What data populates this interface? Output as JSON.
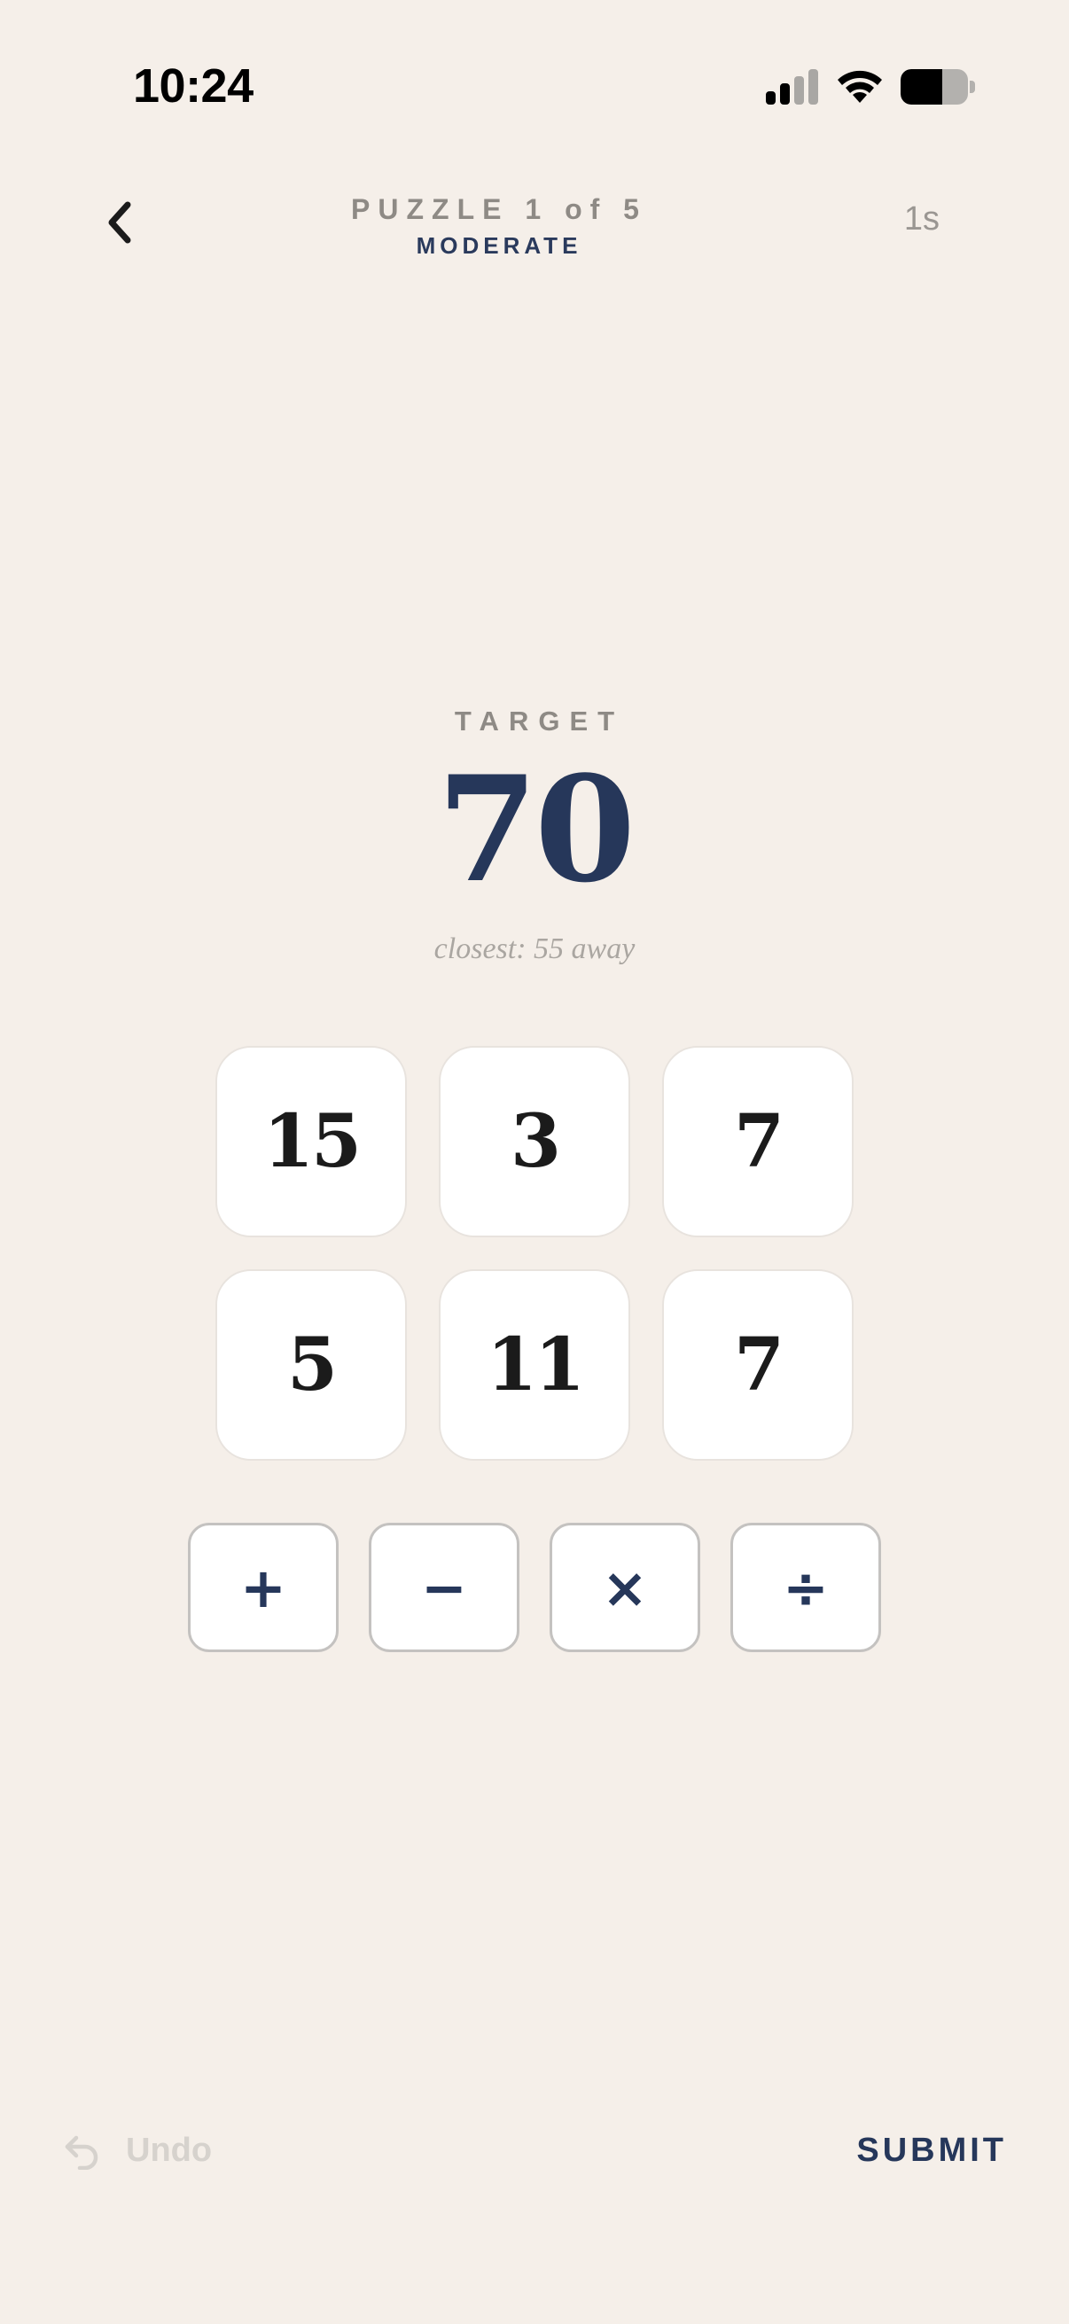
{
  "status_bar": {
    "time": "10:24",
    "battery_level": 0.62,
    "signal_bars_active": 2,
    "signal_bars_total": 4
  },
  "header": {
    "puzzle_label": "PUZZLE 1 of 5",
    "difficulty": "MODERATE",
    "timer": "1s",
    "back_icon": "chevron-left-icon"
  },
  "target": {
    "label": "TARGET",
    "value": "70",
    "closest": "closest: 55 away"
  },
  "tiles": [
    "15",
    "3",
    "7",
    "5",
    "11",
    "7"
  ],
  "operators": [
    {
      "symbol": "+",
      "name": "plus"
    },
    {
      "symbol": "−",
      "name": "minus"
    },
    {
      "symbol": "×",
      "name": "times"
    },
    {
      "symbol": "÷",
      "name": "divide"
    }
  ],
  "controls": {
    "undo_label": "Undo",
    "undo_icon": "undo-arrow-icon",
    "submit_label": "SUBMIT"
  },
  "colors": {
    "background": "#f5efe9",
    "accent": "#26375a",
    "muted": "#8e8a85",
    "disabled": "#d6d2cd"
  }
}
